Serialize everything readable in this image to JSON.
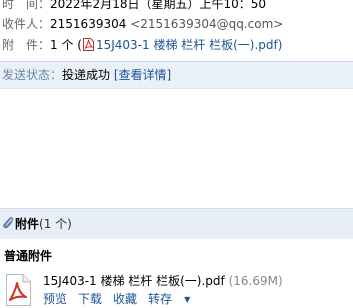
{
  "header": {
    "time_label": "时　间：",
    "time_value": "2022年2月18日（星期五）上午10：50",
    "recipient_label": "收件人：",
    "recipient_name": "2151639304",
    "recipient_email": "<2151639304@qq.com>",
    "attachment_label": "附　件：",
    "attachment_count": "1 个 (",
    "attachment_file": "15J403-1 楼梯 栏杆 栏板(一).pdf",
    "attachment_close": ")"
  },
  "status": {
    "label": "发送状态：",
    "value": "投递成功",
    "details_link": "[查看详情]"
  },
  "attachments": {
    "title": "附件",
    "count": "(1 个)",
    "section_title": "普通附件",
    "file": {
      "name": "15J403-1 楼梯 栏杆 栏板(一).pdf",
      "size": "(16.69M)",
      "actions": {
        "preview": "预览",
        "download": "下载",
        "favorite": "收藏",
        "forward": "转存"
      }
    }
  },
  "colors": {
    "link": "#1e5494",
    "status_bar_bg": "#eaf0f8",
    "attach_bar_bg": "#e7eef7",
    "pdf_red": "#d0312d"
  }
}
